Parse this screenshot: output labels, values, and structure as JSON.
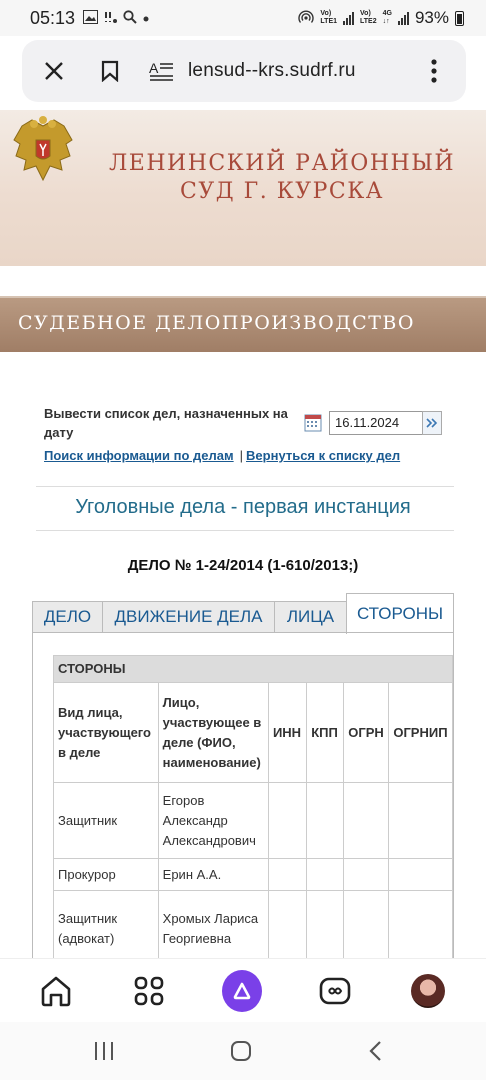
{
  "status_bar": {
    "time": "05:13",
    "battery_pct": "93%",
    "sim1_top": "Vo)",
    "sim1_bottom": "LTE1",
    "sim2_top": "Vo)",
    "sim2_bottom": "LTE2",
    "net_type_top": "4G",
    "net_type_bottom": "↓↑"
  },
  "browser": {
    "url": "lensud--krs.sudrf.ru"
  },
  "banner": {
    "line1": "ЛЕНИНСКИЙ РАЙОННЫЙ",
    "line2": "СУД Г. КУРСКА"
  },
  "section": {
    "title": "СУДЕБНОЕ ДЕЛОПРОИЗВОДСТВО"
  },
  "date_filter": {
    "label": "Вывести список дел, назначенных на дату",
    "value": "16.11.2024"
  },
  "links": {
    "search": "Поиск информации по делам",
    "separator": "|",
    "back": "Вернуться к списку дел"
  },
  "case": {
    "type": "Уголовные дела - первая инстанция",
    "number": "ДЕЛО № 1-24/2014 (1-610/2013;)"
  },
  "tabs": [
    {
      "label": "ДЕЛО",
      "active": false
    },
    {
      "label": "ДВИЖЕНИЕ ДЕЛА",
      "active": false
    },
    {
      "label": "ЛИЦА",
      "active": false
    },
    {
      "label": "СТОРОНЫ",
      "active": true
    }
  ],
  "parties_table": {
    "title": "СТОРОНЫ",
    "headers": [
      "Вид лица, участвующего в деле",
      "Лицо, участвующее в деле (ФИО, наименование)",
      "ИНН",
      "КПП",
      "ОГРН",
      "ОГРНИП"
    ],
    "rows": [
      {
        "role": "Защитник",
        "name": "Егоров Александр Александрович"
      },
      {
        "role": "Прокурор",
        "name": "Ерин А.А."
      },
      {
        "role": "Защитник (адвокат)",
        "name": "Хромых Лариса Георгиевна"
      }
    ]
  }
}
